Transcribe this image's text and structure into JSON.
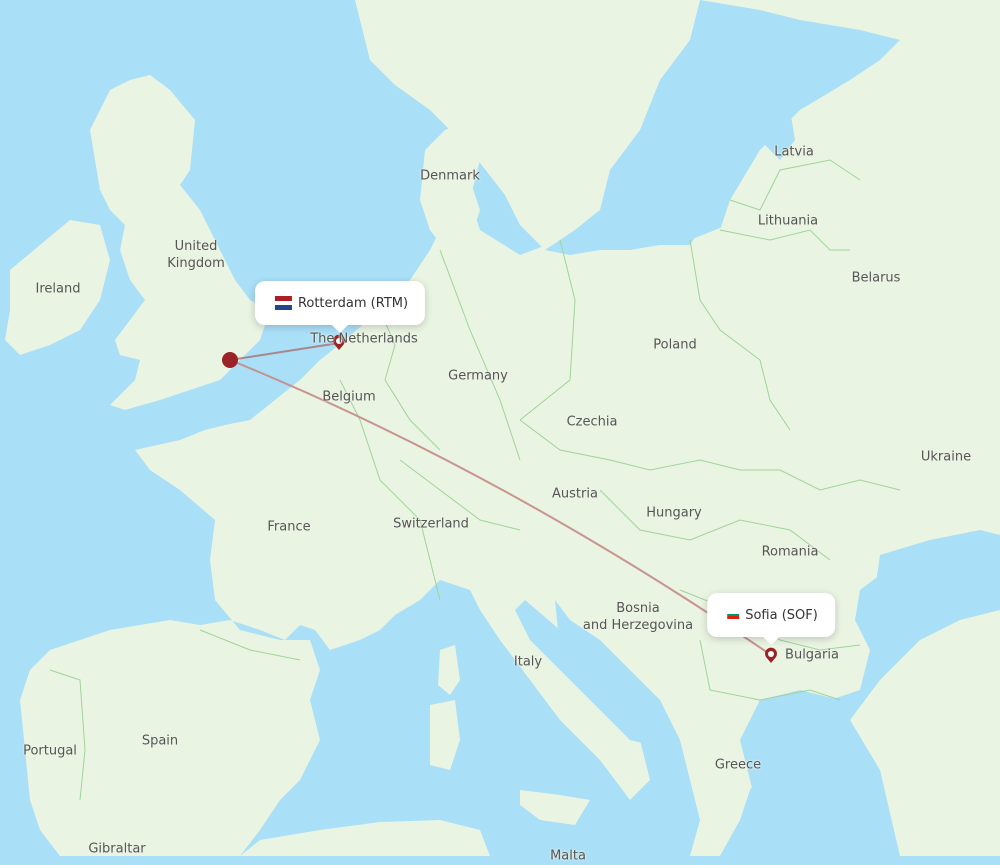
{
  "map": {
    "type": "flight-route-map",
    "colors": {
      "water": "#aadff8",
      "land": "#eaf4e2",
      "border": "#9fd49a",
      "route": "#c48a86",
      "marker": "#9b2226"
    },
    "country_labels": [
      {
        "id": "ireland",
        "text": "Ireland"
      },
      {
        "id": "uk",
        "text": "United\nKingdom"
      },
      {
        "id": "denmark",
        "text": "Denmark"
      },
      {
        "id": "netherlands",
        "text": "The Netherlands"
      },
      {
        "id": "belgium",
        "text": "Belgium"
      },
      {
        "id": "germany",
        "text": "Germany"
      },
      {
        "id": "poland",
        "text": "Poland"
      },
      {
        "id": "latvia",
        "text": "Latvia"
      },
      {
        "id": "lithuania",
        "text": "Lithuania"
      },
      {
        "id": "belarus",
        "text": "Belarus"
      },
      {
        "id": "ukraine",
        "text": "Ukraine"
      },
      {
        "id": "czechia",
        "text": "Czechia"
      },
      {
        "id": "austria",
        "text": "Austria"
      },
      {
        "id": "hungary",
        "text": "Hungary"
      },
      {
        "id": "romania",
        "text": "Romania"
      },
      {
        "id": "switzerland",
        "text": "Switzerland"
      },
      {
        "id": "france",
        "text": "France"
      },
      {
        "id": "bosnia",
        "text": "Bosnia\nand Herzegovina"
      },
      {
        "id": "bulgaria",
        "text": "Bulgaria"
      },
      {
        "id": "italy",
        "text": "Italy"
      },
      {
        "id": "greece",
        "text": "Greece"
      },
      {
        "id": "spain",
        "text": "Spain"
      },
      {
        "id": "portugal",
        "text": "Portugal"
      },
      {
        "id": "gibraltar",
        "text": "Gibraltar"
      },
      {
        "id": "malta",
        "text": "Malta"
      }
    ],
    "airports": [
      {
        "id": "rtm",
        "label": "Rotterdam (RTM)",
        "city": "Rotterdam",
        "code": "RTM",
        "flag": [
          "#ae1c28",
          "#ffffff",
          "#21468b"
        ]
      },
      {
        "id": "sof",
        "label": "Sofia (SOF)",
        "city": "Sofia",
        "code": "SOF",
        "flag": [
          "#ffffff",
          "#00966e",
          "#d62612"
        ]
      }
    ],
    "origin_hub": {
      "id": "london-area",
      "label": ""
    },
    "routes": [
      {
        "from": "london-area",
        "to": "rtm"
      },
      {
        "from": "london-area",
        "to": "sof"
      }
    ]
  }
}
